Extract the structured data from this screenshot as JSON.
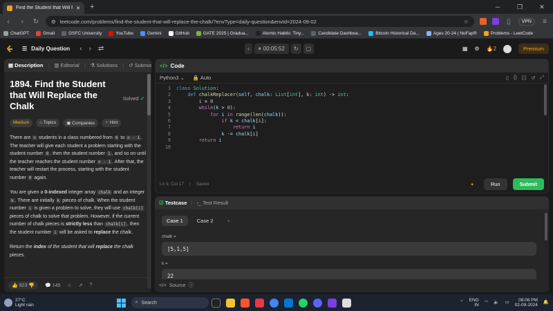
{
  "browser": {
    "tab_title": "Find the Student that Will Repl",
    "new_tab": "+",
    "url": "leetcode.com/problems/find-the-student-that-will-replace-the-chalk/?envType=daily-question&envId=2024-09-02",
    "vpn": "VPN"
  },
  "bookmarks": [
    {
      "label": "ChatGPT",
      "color": "#9aa0a6"
    },
    {
      "label": "Gmail",
      "color": "#ea4335"
    },
    {
      "label": "GSFC University",
      "color": "#5f6368"
    },
    {
      "label": "YouTube",
      "color": "#ff0000"
    },
    {
      "label": "Gemini",
      "color": "#4f8ff7"
    },
    {
      "label": "GitHub",
      "color": "#ffffff"
    },
    {
      "label": "GATE 2025 | Gradua...",
      "color": "#7cb342"
    },
    {
      "label": "Atomic Habits: Tiny...",
      "color": "#222222"
    },
    {
      "label": "Candidate Dashboa...",
      "color": "#5f6368"
    },
    {
      "label": "Bitcoin Historical Da...",
      "color": "#20beff"
    },
    {
      "label": "Ages 20-24 | NoFap®",
      "color": "#8ab4f8"
    },
    {
      "label": "Problems - LeetCode",
      "color": "#ffa116"
    }
  ],
  "header": {
    "daily": "Daily Question",
    "timer": "00:05:52",
    "streak": "2",
    "premium": "Premium"
  },
  "problem": {
    "tabs": {
      "description": "Description",
      "editorial": "Editorial",
      "solutions": "Solutions",
      "submissions": "Submission"
    },
    "title": "1894. Find the Student that Will Replace the Chalk",
    "solved": "Solved",
    "tags": {
      "difficulty": "Medium",
      "topics": "Topics",
      "companies": "Companies",
      "hint": "Hint"
    },
    "p1": {
      "a": "There are ",
      "n": "n",
      "b": " students in a class numbered from ",
      "zero": "0",
      "c": " to ",
      "nm1": "n - 1",
      "d": ". The teacher will give each student a problem starting with the student number ",
      "zero2": "0",
      "e": ", then the student number ",
      "one": "1",
      "f": ", and so on until the teacher reaches the student number ",
      "nm1b": "n - 1",
      "g": ". After that, the teacher will restart the process, starting with the student number ",
      "zero3": "0",
      "h": " again."
    },
    "p2": {
      "a": "You are given a ",
      "idx": "0-indexed",
      "b": " integer array ",
      "chalk": "chalk",
      "c": " and an integer ",
      "k": "k",
      "d": ". There are initially ",
      "k2": "k",
      "e": " pieces of chalk. When the student number ",
      "i": "i",
      "f": " is given a problem to solve, they will use ",
      "chalki": "chalk[i]",
      "g": " pieces of chalk to solve that problem. However, if the current number of chalk pieces is ",
      "strict": "strictly less",
      "h": " than ",
      "chalki2": "chalk[i]",
      "j": ", then the student number ",
      "i2": "i",
      "l": " will be asked to ",
      "replace": "replace",
      "m": " the chalk."
    },
    "p3": {
      "a": "Return the ",
      "index": "index",
      "b": " of the student that will ",
      "replace": "replace",
      "c": " the chalk pieces."
    },
    "likes": "923",
    "comments": "145"
  },
  "code": {
    "title": "Code",
    "language": "Python3",
    "auto": "Auto",
    "lines": [
      "1",
      "2",
      "3",
      "4",
      "5",
      "6",
      "7",
      "8",
      "9",
      "10"
    ],
    "cursor": "Ln 9, Col 17",
    "saved": "Saved",
    "run": "Run",
    "submit": "Submit"
  },
  "testcase": {
    "tab_testcase": "Testcase",
    "tab_result": "Test Result",
    "case1": "Case 1",
    "case2": "Case 2",
    "add": "+",
    "chalk_label": "chalk =",
    "chalk_value": "[5,1,5]",
    "k_label": "k =",
    "k_value": "22",
    "source": "Source"
  },
  "taskbar": {
    "temp": "27°C",
    "weather": "Light rain",
    "search": "Search",
    "lang1": "ENG",
    "lang2": "IN",
    "time": "08:06 PM",
    "date": "02-09-2024"
  }
}
